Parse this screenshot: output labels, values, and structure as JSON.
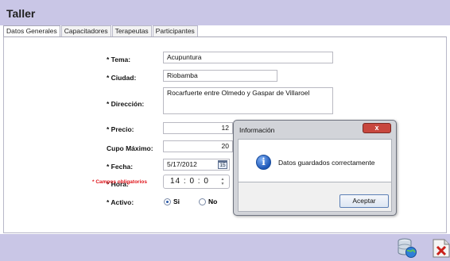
{
  "window": {
    "title": "Taller"
  },
  "tabs": [
    {
      "label": "Datos Generales"
    },
    {
      "label": "Capacitadores"
    },
    {
      "label": "Terapeutas"
    },
    {
      "label": "Participantes"
    }
  ],
  "form": {
    "tema": {
      "label": "* Tema:",
      "value": "Acupuntura"
    },
    "ciudad": {
      "label": "* Ciudad:",
      "value": "Riobamba"
    },
    "direccion": {
      "label": "* Dirección:",
      "value": "Rocarfuerte entre Olmedo y Gaspar de Villaroel"
    },
    "precio": {
      "label": "* Precio:",
      "value": "12"
    },
    "cupo": {
      "label": "Cupo Máximo:",
      "value": "20"
    },
    "fecha": {
      "label": "* Fecha:",
      "value": "5/17/2012",
      "calendar_day": "15"
    },
    "hora": {
      "label": "* Hora:",
      "value": "14 : 0 : 0"
    },
    "activo": {
      "label": "* Activo:",
      "options": [
        "Si",
        "No"
      ],
      "selected": "Si"
    },
    "required_note": "* Campos obligatorios"
  },
  "dialog": {
    "title": "Información",
    "close_label": "x",
    "message": "Datos guardados correctamente",
    "ok_label": "Aceptar"
  },
  "toolbar": {
    "icons": [
      "save-database-icon",
      "delete-icon"
    ]
  },
  "colors": {
    "header_bg": "#c9c6e6",
    "close_btn": "#c8473e",
    "required_text": "#e0141a"
  }
}
